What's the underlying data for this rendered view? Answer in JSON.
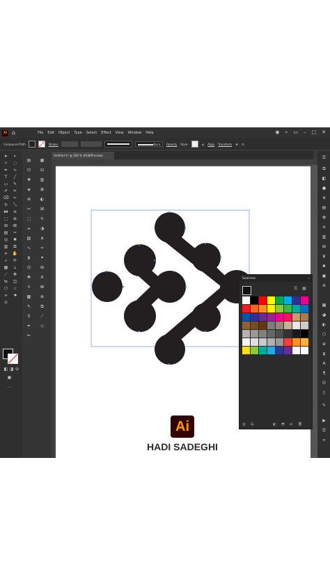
{
  "app": {
    "badge": "Ai",
    "menu": [
      "File",
      "Edit",
      "Object",
      "Type",
      "Select",
      "Effect",
      "View",
      "Window",
      "Help"
    ]
  },
  "control_bar": {
    "selection_type": "Compound Path",
    "stroke_label": "Stroke:",
    "basic_label": "Basic",
    "opacity_label": "Opacity",
    "style_label": "Style:",
    "align_label": "Align",
    "transform_label": "Transform"
  },
  "document_tab": {
    "title": "Untitled-1* @ 200 % (RGB/Preview)"
  },
  "swatches_panel": {
    "title": "Swatches",
    "colors": [
      "#ffffff",
      "#000000",
      "#ff0000",
      "#ffff00",
      "#00a651",
      "#00aeef",
      "#2e3192",
      "#ec008c",
      "#ed1c24",
      "#f26522",
      "#f7941d",
      "#fff200",
      "#8dc63f",
      "#39b54a",
      "#00a99d",
      "#0072bc",
      "#0054a6",
      "#2e3192",
      "#662d91",
      "#92278f",
      "#ec008c",
      "#ed145b",
      "#c69c6d",
      "#a67c52",
      "#8c6239",
      "#754c24",
      "#603913",
      "#7d7d7d",
      "#998675",
      "#c7b299",
      "#e6e6e6",
      "#cccccc",
      "#b3b3b3",
      "#999999",
      "#808080",
      "#666666",
      "#4d4d4d",
      "#333333",
      "#1a1a1a",
      "#000000",
      "#f5f5f5",
      "#e0e0e0",
      "#c8c8c8",
      "#b0b0b0",
      "#989898",
      "#ef4136",
      "#f7941d",
      "#fbb040",
      "#ffde17",
      "#8dc63f",
      "#00a79d",
      "#27aae1",
      "#2b3990",
      "#662d91",
      "#ffffff",
      "#ffffff"
    ]
  },
  "branding": {
    "logo": "Ai",
    "name": "HADI SADEGHI"
  }
}
